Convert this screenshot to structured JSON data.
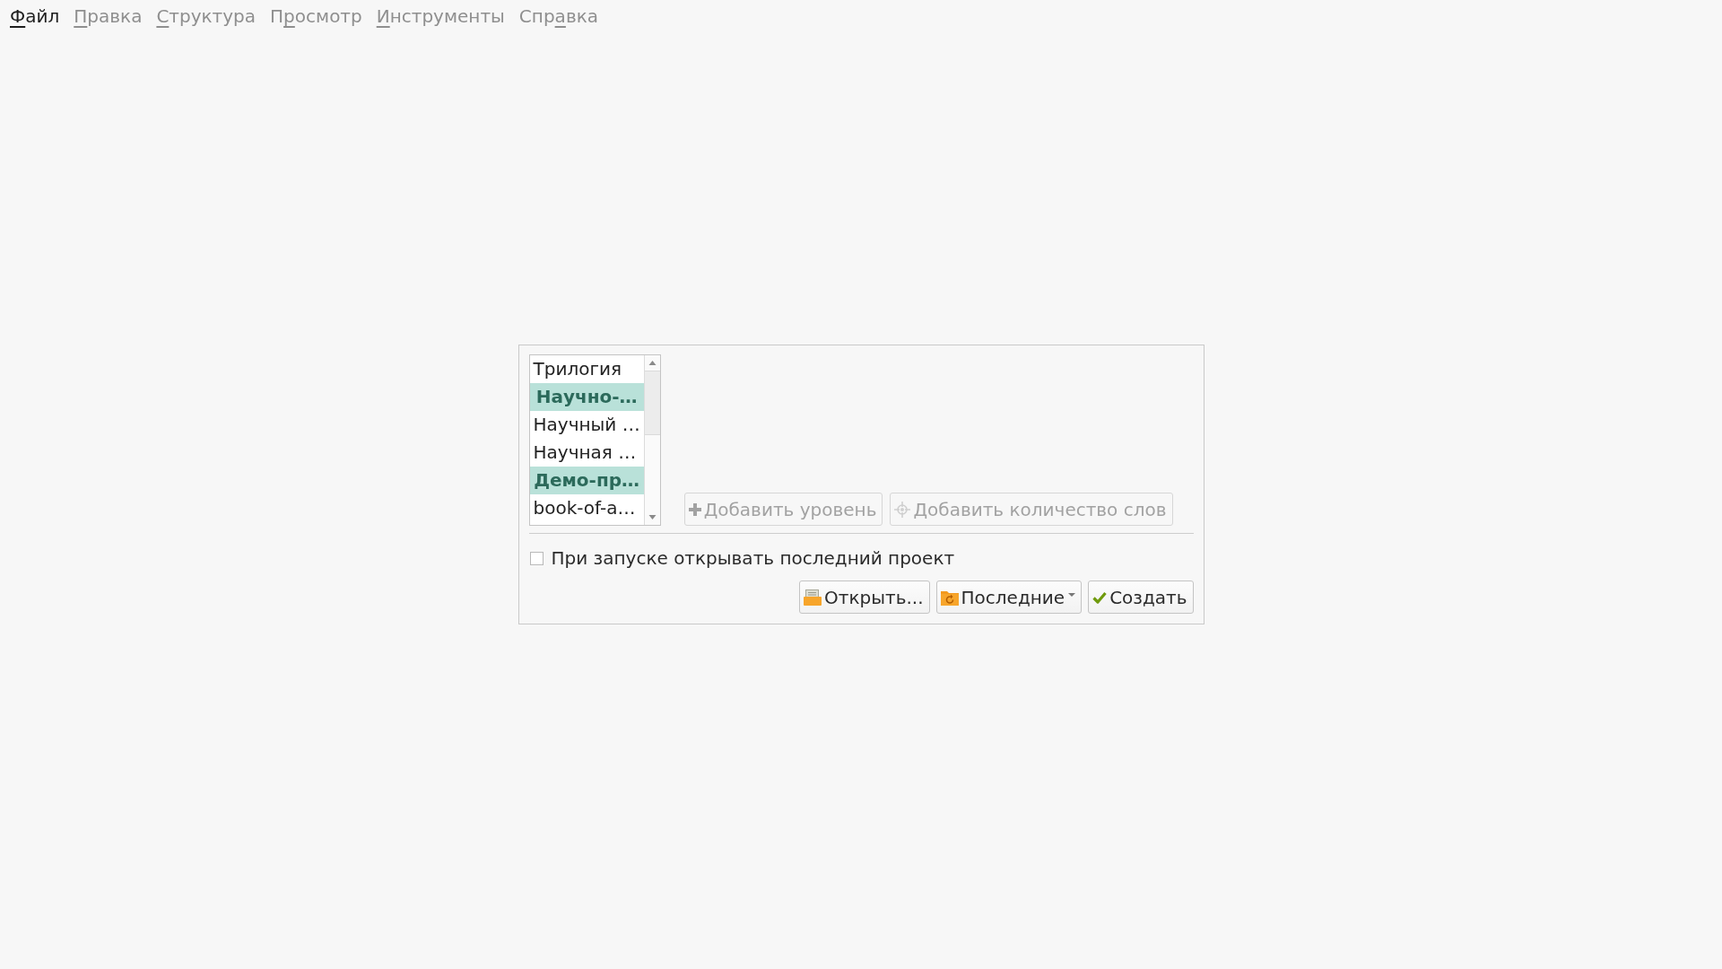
{
  "menu": [
    {
      "key": "Ф",
      "rest": "айл",
      "disabled": false
    },
    {
      "key": "П",
      "rest": "равка",
      "disabled": true
    },
    {
      "key": "С",
      "rest": "труктура",
      "disabled": true
    },
    {
      "before": "П",
      "key": "р",
      "rest": "осмотр",
      "disabled": true
    },
    {
      "key": "И",
      "rest": "нструменты",
      "disabled": true
    },
    {
      "before": "Спр",
      "key": "а",
      "rest": "вка",
      "disabled": true
    }
  ],
  "templates": [
    {
      "label": "Трилогия",
      "kind": "item"
    },
    {
      "label": "Научно-…",
      "kind": "header"
    },
    {
      "label": "Научный …",
      "kind": "item"
    },
    {
      "label": "Научная …",
      "kind": "item"
    },
    {
      "label": "Демо-пр…",
      "kind": "header"
    },
    {
      "label": "book-of-a…",
      "kind": "item"
    }
  ],
  "add_level_button": {
    "label": "Добавить уровень",
    "disabled": true
  },
  "add_word_count_button": {
    "label": "Добавить количество слов",
    "disabled": true
  },
  "open_last_project": {
    "label": "При запуске открывать последний проект",
    "checked": false
  },
  "open_button": {
    "label": "Открыть..."
  },
  "recent_button": {
    "label": "Последние"
  },
  "create_button": {
    "label": "Создать"
  }
}
